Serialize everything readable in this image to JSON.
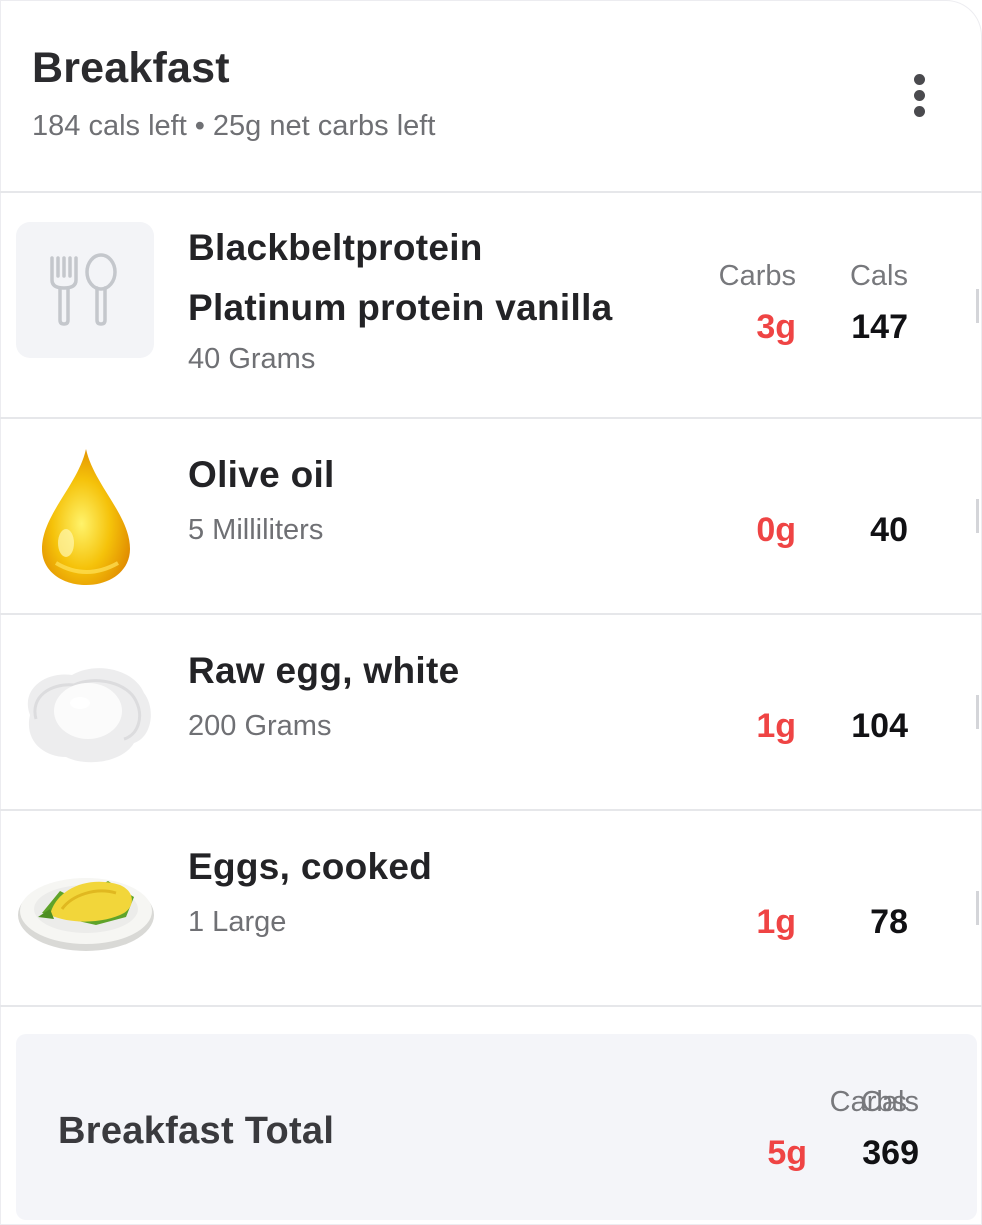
{
  "meal": {
    "title": "Breakfast",
    "cals_left": "184 cals left",
    "separator": "•",
    "carbs_left": "25g net carbs left",
    "more_icon": "more-vertical-icon"
  },
  "columns": {
    "carbs": "Carbs",
    "cals": "Cals"
  },
  "items": [
    {
      "name_line1": "Blackbeltprotein",
      "name_line2": "Platinum protein vanilla",
      "serving": "40 Grams",
      "carbs": "3g",
      "cals": "147",
      "icon": "fork-spoon-icon"
    },
    {
      "name_line1": "Olive oil",
      "serving": "5 Milliliters",
      "carbs": "0g",
      "cals": "40",
      "icon": "oil-drop-icon"
    },
    {
      "name_line1": "Raw egg, white",
      "serving": "200 Grams",
      "carbs": "1g",
      "cals": "104",
      "icon": "raw-egg-icon"
    },
    {
      "name_line1": "Eggs, cooked",
      "serving": "1 Large",
      "carbs": "1g",
      "cals": "78",
      "icon": "omelette-plate-icon"
    }
  ],
  "total": {
    "label": "Breakfast Total",
    "carbs": "5g",
    "cals": "369"
  },
  "colors": {
    "carbs_accent": "#ef4444",
    "text_primary": "#232326",
    "text_secondary": "#6f7074"
  }
}
